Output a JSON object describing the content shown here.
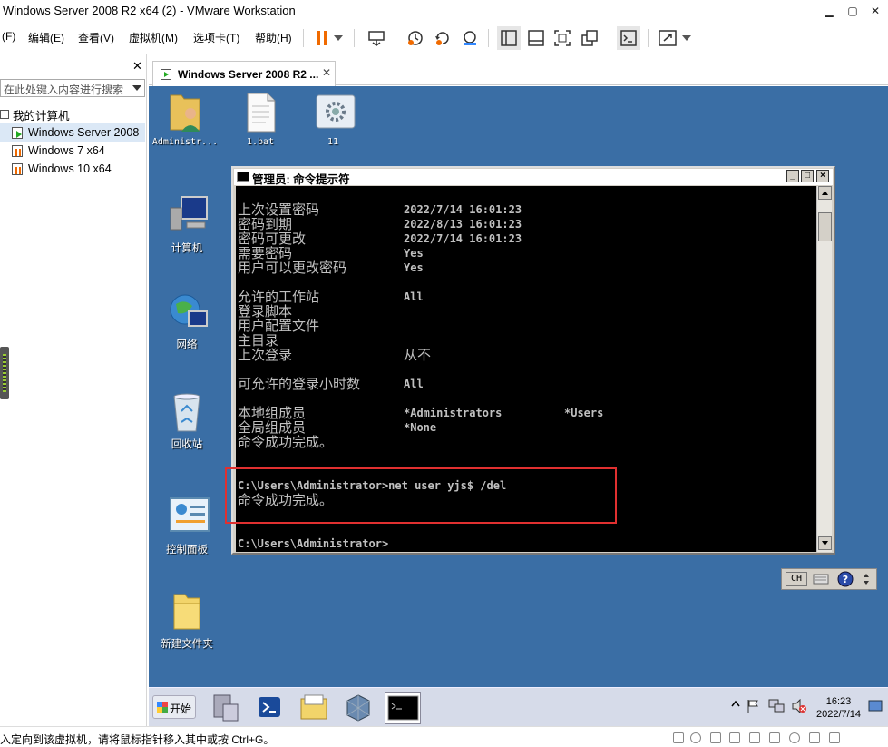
{
  "window": {
    "title": "Windows Server 2008 R2 x64 (2) - VMware Workstation",
    "minimize": "▁",
    "maximize": "▢",
    "close": "✕"
  },
  "menu": [
    "(F)",
    "编辑(E)",
    "查看(V)",
    "虚拟机(M)",
    "选项卡(T)",
    "帮助(H)"
  ],
  "library": {
    "close": "✕",
    "search_placeholder": "在此处键入内容进行搜索",
    "root": "我的计算机",
    "vms": [
      "Windows Server 2008",
      "Windows 7 x64",
      "Windows 10 x64"
    ]
  },
  "tab": {
    "label": "Windows Server 2008 R2 ...",
    "close": "✕"
  },
  "desktop_icons": {
    "admin": "Administr...",
    "bat": "1.bat",
    "eleven": "11",
    "computer": "计算机",
    "network": "网络",
    "recycle": "回收站",
    "control_panel": "控制面板",
    "new_folder": "新建文件夹"
  },
  "cmd": {
    "title": "管理员: 命令提示符",
    "rows": [
      {
        "k": "上次设置密码",
        "v": "2022/7/14 16:01:23"
      },
      {
        "k": "密码到期",
        "v": "2022/8/13 16:01:23"
      },
      {
        "k": "密码可更改",
        "v": "2022/7/14 16:01:23"
      },
      {
        "k": "需要密码",
        "v": "Yes"
      },
      {
        "k": "用户可以更改密码",
        "v": "Yes"
      },
      {
        "k": "允许的工作站",
        "v": "All"
      },
      {
        "k": "登录脚本",
        "v": ""
      },
      {
        "k": "用户配置文件",
        "v": ""
      },
      {
        "k": "主目录",
        "v": ""
      },
      {
        "k": "上次登录",
        "v": "从不"
      },
      {
        "k": "可允许的登录小时数",
        "v": "All"
      },
      {
        "k": "本地组成员",
        "v": "*Administrators",
        "v2": "*Users"
      },
      {
        "k": "全局组成员",
        "v": "*None"
      }
    ],
    "done1": "命令成功完成。",
    "command": "C:\\Users\\Administrator>net user yjs$ /del",
    "done2": "命令成功完成。",
    "prompt": "C:\\Users\\Administrator>"
  },
  "langbar": {
    "ch": "CH"
  },
  "taskbar": {
    "start": "开始",
    "time": "16:23",
    "date": "2022/7/14"
  },
  "status": {
    "text": "入定向到该虚拟机，请将鼠标指针移入其中或按 Ctrl+G。"
  },
  "colors": {
    "desktop": "#3a6ea5",
    "highlight": "#e03030",
    "pause": "#f06a00"
  }
}
